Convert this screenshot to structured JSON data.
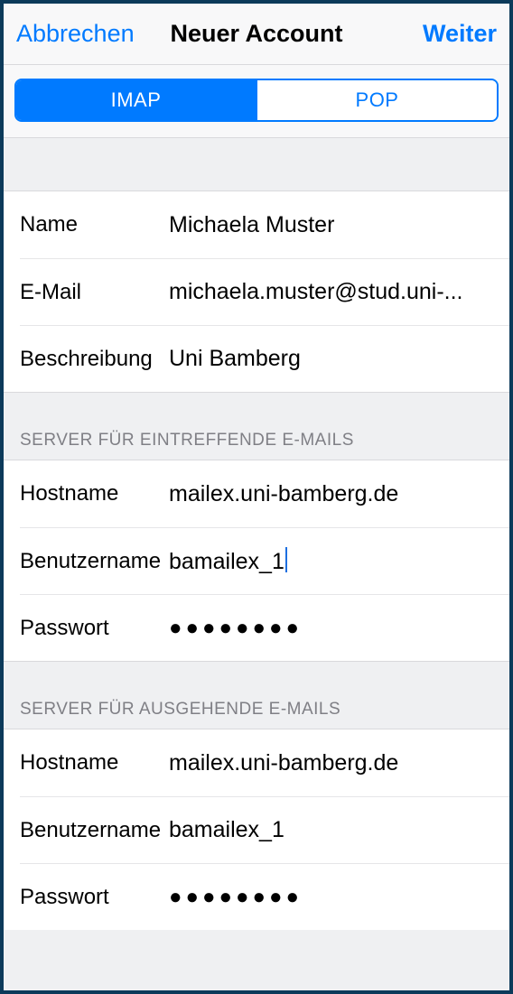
{
  "header": {
    "cancel": "Abbrechen",
    "title": "Neuer Account",
    "next": "Weiter"
  },
  "tabs": {
    "imap": "IMAP",
    "pop": "POP"
  },
  "account": {
    "name_label": "Name",
    "name_value": "Michaela Muster",
    "email_label": "E-Mail",
    "email_value": "michaela.muster@stud.uni-...",
    "desc_label": "Beschreibung",
    "desc_value": "Uni Bamberg"
  },
  "incoming": {
    "header": "SERVER FÜR EINTREFFENDE E-MAILS",
    "host_label": "Hostname",
    "host_value": "mailex.uni-bamberg.de",
    "user_label": "Benutzername",
    "user_value": "bamailex_1",
    "pass_label": "Passwort",
    "pass_value": "●●●●●●●●"
  },
  "outgoing": {
    "header": "SERVER FÜR AUSGEHENDE E-MAILS",
    "host_label": "Hostname",
    "host_value": "mailex.uni-bamberg.de",
    "user_label": "Benutzername",
    "user_value": "bamailex_1",
    "pass_label": "Passwort",
    "pass_value": "●●●●●●●●"
  }
}
